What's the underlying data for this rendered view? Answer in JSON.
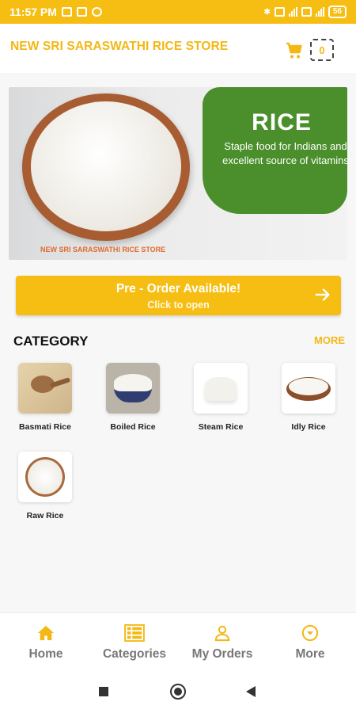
{
  "status_bar": {
    "time": "11:57 PM",
    "battery": "56",
    "network": "4G"
  },
  "header": {
    "store_name": "NEW SRI SARASWATHI RICE STORE",
    "cart_count": "0",
    "accent_color": "#f3b814"
  },
  "banner": {
    "headline": "RICE",
    "tagline": "Staple food for Indians and excellent source of vitamins",
    "store_name": "NEW SRI SARASWATHI RICE STORE"
  },
  "preorder": {
    "title": "Pre - Order Available!",
    "subtitle": "Click to open"
  },
  "category": {
    "title": "CATEGORY",
    "more_label": "MORE",
    "items": [
      {
        "label": "Basmati Rice"
      },
      {
        "label": "Boiled Rice"
      },
      {
        "label": "Steam Rice"
      },
      {
        "label": "Idly Rice"
      },
      {
        "label": "Raw Rice"
      }
    ]
  },
  "bottom_nav": {
    "items": [
      {
        "label": "Home",
        "icon": "home-icon",
        "active": true
      },
      {
        "label": "Categories",
        "icon": "categories-icon"
      },
      {
        "label": "My Orders",
        "icon": "user-icon"
      },
      {
        "label": "More",
        "icon": "chevron-circle-icon"
      }
    ]
  }
}
